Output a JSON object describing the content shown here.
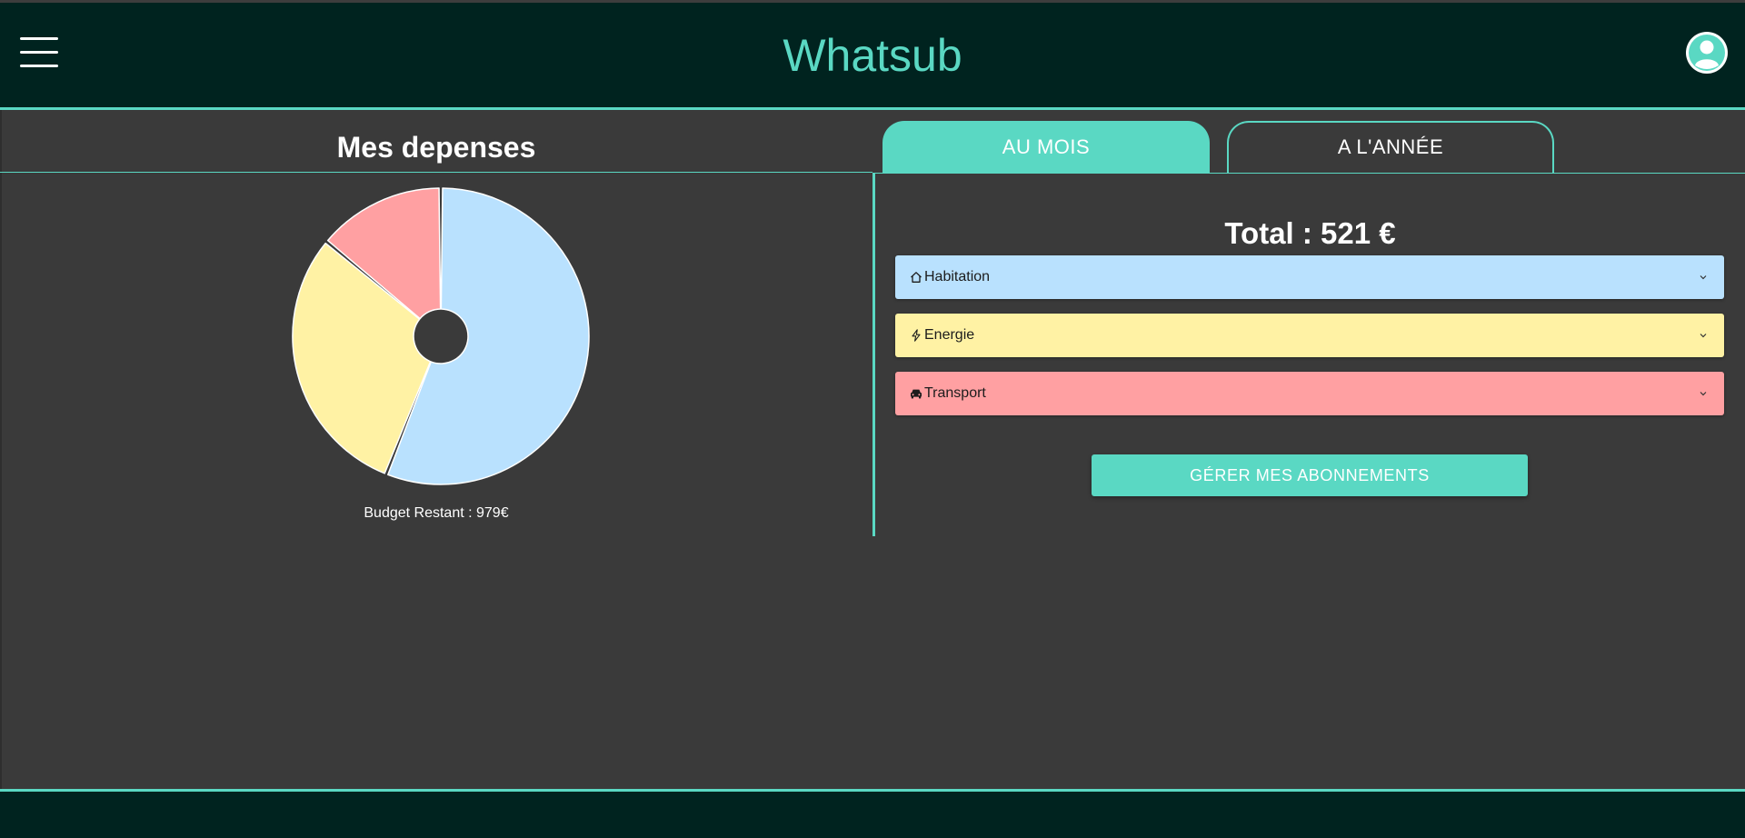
{
  "header": {
    "title": "Whatsub",
    "menu_icon": "hamburger-menu-icon",
    "profile_icon": "user-avatar-icon"
  },
  "expenses": {
    "title": "Mes depenses",
    "budget_text": "Budget Restant : 979€"
  },
  "tabs": [
    {
      "label": "AU MOIS",
      "active": true
    },
    {
      "label": "A L'ANNÉE",
      "active": false
    }
  ],
  "summary": {
    "total_text": "Total : 521 €"
  },
  "categories": [
    {
      "label": "Habitation",
      "icon": "home-icon",
      "color": "#b9e1fe"
    },
    {
      "label": "Energie",
      "icon": "lightning-icon",
      "color": "#fff2a4"
    },
    {
      "label": "Transport",
      "icon": "car-icon",
      "color": "#ffa0a2"
    }
  ],
  "manage_button": {
    "label": "GÉRER MES ABONNEMENTS"
  },
  "colors": {
    "accent": "#5ad8c3",
    "header_bg": "#00231f",
    "page_bg": "#3a3a3a"
  },
  "chart_data": {
    "type": "pie",
    "categories": [
      "Habitation",
      "Energie",
      "Transport"
    ],
    "values": [
      56,
      30,
      14
    ],
    "colors": [
      "#b9e1fe",
      "#fff2a4",
      "#ffa0a2"
    ]
  }
}
